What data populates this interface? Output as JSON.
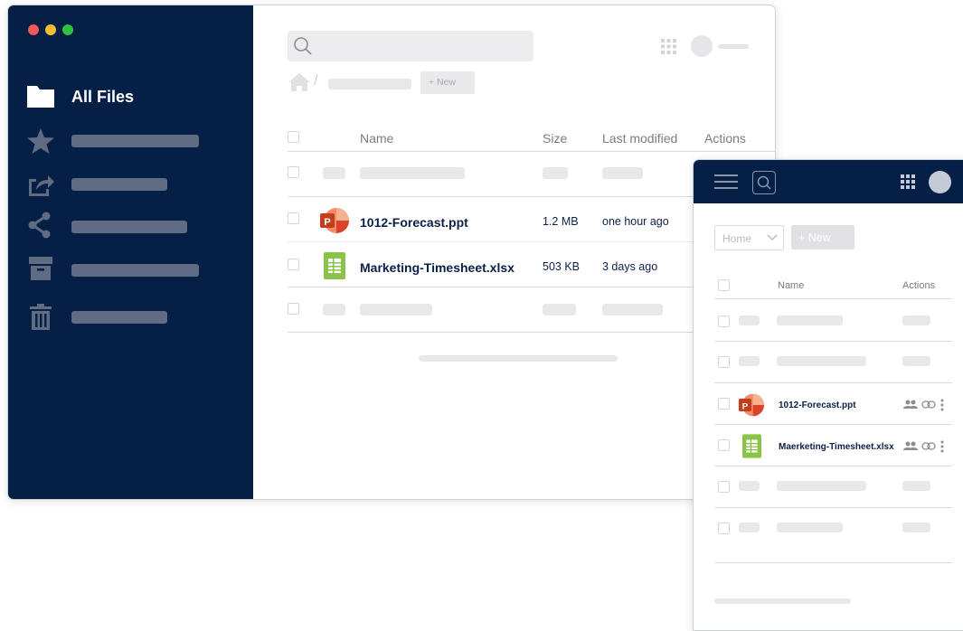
{
  "desktop": {
    "window_controls": {
      "close_color": "#ee5a5a",
      "minimize_color": "#f5be2e",
      "maximize_color": "#2fc242"
    },
    "sidebar": {
      "active_item_label": "All Files",
      "icons": [
        "folder-icon",
        "star-icon",
        "shared-icon",
        "share-icon",
        "archive-icon",
        "trash-icon"
      ],
      "background": "#051f46"
    },
    "toolbar": {
      "new_button_label": "+ New"
    },
    "table": {
      "headers": {
        "name": "Name",
        "size": "Size",
        "last_modified": "Last modified",
        "actions": "Actions"
      },
      "rows": [
        {
          "name": "1012-Forecast.ppt",
          "size": "1.2 MB",
          "modified": "one hour ago",
          "type": "powerpoint"
        },
        {
          "name": "Marketing-Timesheet.xlsx",
          "size": "503 KB",
          "modified": "3 days ago",
          "type": "spreadsheet"
        }
      ]
    }
  },
  "mobile": {
    "location_select": "Home",
    "new_button_label": "+ New",
    "headers": {
      "name": "Name",
      "actions": "Actions"
    },
    "rows": [
      {
        "name": "1012-Forecast.ppt",
        "type": "powerpoint"
      },
      {
        "name": "Maerketing-Timesheet.xlsx",
        "type": "spreadsheet"
      }
    ]
  },
  "colors": {
    "navy": "#051f46",
    "powerpoint": "#d9442b",
    "spreadsheet": "#8bc34a"
  }
}
